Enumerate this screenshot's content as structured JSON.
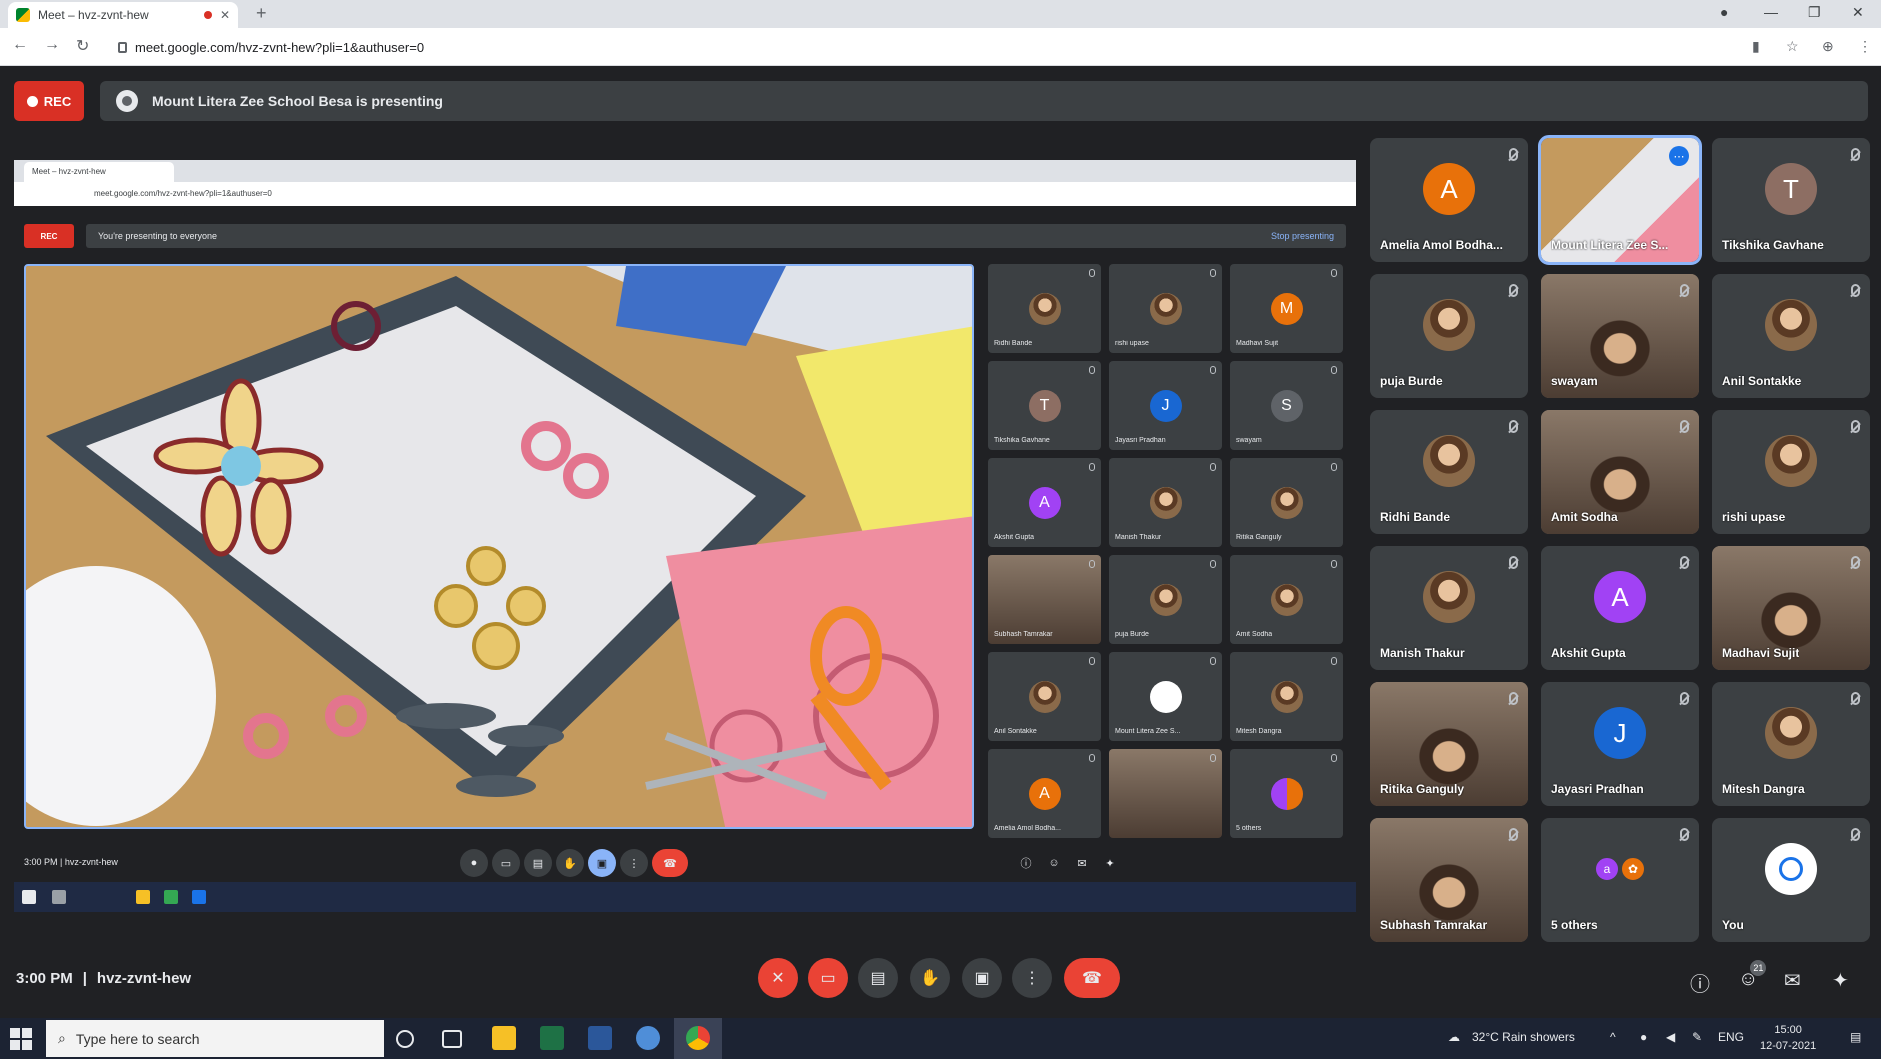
{
  "browser": {
    "tab_title": "Meet – hvz-zvnt-hew",
    "url": "meet.google.com/hvz-zvnt-hew?pli=1&authuser=0"
  },
  "meet": {
    "rec_label": "REC",
    "presenting_text": "Mount Litera Zee School Besa is presenting",
    "time": "3:00 PM",
    "meeting_code": "hvz-zvnt-hew",
    "participants_badge": "21"
  },
  "shared_screen": {
    "tab_title": "Meet – hvz-zvnt-hew",
    "url": "meet.google.com/hvz-zvnt-hew?pli=1&authuser=0",
    "rec_label": "REC",
    "presenting_text": "You're presenting to everyone",
    "stop_label": "Stop presenting",
    "time": "3:00 PM | hvz-zvnt-hew",
    "tiles": [
      {
        "name": "Ridhi Bande",
        "kind": "photo"
      },
      {
        "name": "rishi upase",
        "kind": "photo"
      },
      {
        "name": "Madhavi Sujit",
        "initial": "M",
        "color": "#e8710a"
      },
      {
        "name": "Tikshika Gavhane",
        "initial": "T",
        "color": "#8d6e63"
      },
      {
        "name": "Jayasri Pradhan",
        "initial": "J",
        "color": "#1967d2"
      },
      {
        "name": "swayam",
        "initial": "S",
        "color": "#5f6368"
      },
      {
        "name": "Akshit Gupta",
        "initial": "A",
        "color": "#a142f4"
      },
      {
        "name": "Manish Thakur",
        "kind": "photo"
      },
      {
        "name": "Ritika Ganguly",
        "kind": "photo"
      },
      {
        "name": "Subhash Tamrakar",
        "kind": "video"
      },
      {
        "name": "puja Burde",
        "kind": "photo"
      },
      {
        "name": "Amit Sodha",
        "kind": "photo"
      },
      {
        "name": "Anil Sontakke",
        "kind": "photo"
      },
      {
        "name": "Mount Litera Zee S...",
        "kind": "logo"
      },
      {
        "name": "Mitesh Dangra",
        "kind": "photo"
      },
      {
        "name": "Amelia Amol Bodha...",
        "initial": "A",
        "color": "#e8710a"
      },
      {
        "name": "",
        "kind": "video"
      },
      {
        "name": "5 others",
        "kind": "others"
      }
    ]
  },
  "participants": [
    {
      "name": "Amelia Amol Bodha...",
      "initial": "A",
      "color": "#e8710a",
      "kind": "avatar"
    },
    {
      "name": "Mount Litera Zee S...",
      "kind": "pinned"
    },
    {
      "name": "Tikshika Gavhane",
      "initial": "T",
      "color": "#8d6e63",
      "kind": "avatar"
    },
    {
      "name": "puja Burde",
      "kind": "photo"
    },
    {
      "name": "swayam",
      "kind": "video"
    },
    {
      "name": "Anil Sontakke",
      "kind": "photo"
    },
    {
      "name": "Ridhi Bande",
      "kind": "photo"
    },
    {
      "name": "Amit Sodha",
      "kind": "video"
    },
    {
      "name": "rishi upase",
      "kind": "photo"
    },
    {
      "name": "Manish Thakur",
      "kind": "photo"
    },
    {
      "name": "Akshit Gupta",
      "initial": "A",
      "color": "#a142f4",
      "kind": "avatar"
    },
    {
      "name": "Madhavi Sujit",
      "kind": "video"
    },
    {
      "name": "Ritika Ganguly",
      "kind": "video"
    },
    {
      "name": "Jayasri Pradhan",
      "initial": "J",
      "color": "#1967d2",
      "kind": "avatar"
    },
    {
      "name": "Mitesh Dangra",
      "kind": "photo"
    },
    {
      "name": "Subhash Tamrakar",
      "kind": "video"
    },
    {
      "name": "5 others",
      "kind": "others"
    },
    {
      "name": "You",
      "kind": "logo"
    }
  ],
  "taskbar": {
    "search_placeholder": "Type here to search",
    "weather": "32°C  Rain showers",
    "lang": "ENG",
    "time": "15:00",
    "date": "12-07-2021"
  },
  "colors": {
    "rec": "#d93025",
    "end_call": "#ea4335",
    "accent": "#8ab4f8",
    "tile": "#3c4043",
    "bg": "#202124"
  }
}
